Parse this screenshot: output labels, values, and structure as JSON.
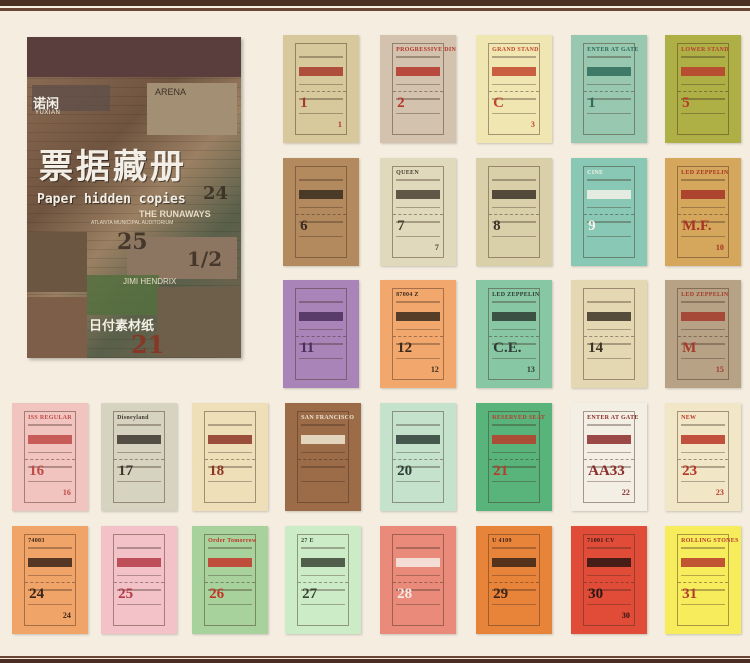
{
  "product": {
    "brand_cn": "诺闲",
    "brand_en": "YUXIAN",
    "title_cn": "票据藏册",
    "title_en": "Paper hidden copies",
    "subtitle_cn": "日付素材纸",
    "collage_texts": [
      "ARENA",
      "THE RUNAWAYS",
      "25",
      "24",
      "1/2",
      "JIMI HENDRIX",
      "21",
      "ATLANTA MUNICIPAL AUDITORIUM"
    ]
  },
  "colors": {
    "page_bg": "#f4ede0",
    "stripe": "#4a2e22",
    "cover_bg": "#3c2a26"
  },
  "cards": [
    {
      "color": "#d8c99c",
      "accent": "#a63a2a",
      "title": "",
      "num": "1",
      "alt": "1",
      "row": 1,
      "col": 1
    },
    {
      "color": "#d3c2ae",
      "accent": "#b4362a",
      "title": "PROGRESSIVE DINNER",
      "num": "2",
      "alt": "",
      "row": 1,
      "col": 2
    },
    {
      "color": "#f0e6b2",
      "accent": "#c2452c",
      "title": "GRAND STAND",
      "num": "C",
      "alt": "3",
      "row": 1,
      "col": 3
    },
    {
      "color": "#98c8b0",
      "accent": "#2e6c5a",
      "title": "ENTER AT GATE",
      "num": "1",
      "alt": "",
      "row": 1,
      "col": 4
    },
    {
      "color": "#aeb046",
      "accent": "#b83c2e",
      "title": "LOWER STAND",
      "num": "5",
      "alt": "",
      "row": 1,
      "col": 5
    },
    {
      "color": "#b28a5e",
      "accent": "#3a2c20",
      "title": "",
      "num": "6",
      "alt": "",
      "row": 2,
      "col": 1
    },
    {
      "color": "#e1d9bb",
      "accent": "#4a4033",
      "title": "QUEEN",
      "num": "7",
      "alt": "7",
      "row": 2,
      "col": 2
    },
    {
      "color": "#d9cfa8",
      "accent": "#3b3329",
      "title": "",
      "num": "8",
      "alt": "",
      "row": 2,
      "col": 3
    },
    {
      "color": "#88c8b4",
      "accent": "#f4f2ea",
      "title": "CINE",
      "num": "9",
      "alt": "",
      "row": 2,
      "col": 4
    },
    {
      "color": "#d5a75c",
      "accent": "#a63324",
      "title": "LED ZEPPELIN",
      "num": "M.F.",
      "alt": "10",
      "row": 2,
      "col": 5
    },
    {
      "color": "#a884b8",
      "accent": "#4b2f5a",
      "title": "",
      "num": "11",
      "alt": "",
      "row": 3,
      "col": 1
    },
    {
      "color": "#f2a86c",
      "accent": "#3a2a1c",
      "title": "87004 Z",
      "num": "12",
      "alt": "12",
      "row": 3,
      "col": 2
    },
    {
      "color": "#88c7a4",
      "accent": "#2d3c33",
      "title": "LED ZEPPELIN",
      "num": "C.E.",
      "alt": "13",
      "row": 3,
      "col": 3
    },
    {
      "color": "#e4d8b2",
      "accent": "#3c3426",
      "title": "",
      "num": "14",
      "alt": "",
      "row": 3,
      "col": 4
    },
    {
      "color": "#b8a286",
      "accent": "#a33a2a",
      "title": "LED ZEPPELIN",
      "num": "M",
      "alt": "15",
      "row": 3,
      "col": 5
    },
    {
      "color": "#f2c4c0",
      "accent": "#c04a45",
      "title": "ISS REGULAR",
      "num": "16",
      "alt": "16",
      "row": 4,
      "col": 1
    },
    {
      "color": "#d7d3c1",
      "accent": "#3c372e",
      "title": "Disneyland",
      "num": "17",
      "alt": "",
      "row": 4,
      "col": 2
    },
    {
      "color": "#eedfb8",
      "accent": "#8b3525",
      "title": "",
      "num": "18",
      "alt": "",
      "row": 4,
      "col": 3
    },
    {
      "color": "#9c6b48",
      "accent": "#efe6d2",
      "title": "SAN FRANCISCO",
      "num": "",
      "alt": "",
      "row": 4,
      "col": 4
    },
    {
      "color": "#c5e2cc",
      "accent": "#2e4036",
      "title": "",
      "num": "20",
      "alt": "",
      "row": 4,
      "col": 5
    },
    {
      "color": "#58b47a",
      "accent": "#b83c2d",
      "title": "RESERVED SEAT",
      "num": "21",
      "alt": "",
      "row": 4,
      "col": 6
    },
    {
      "color": "#f3efe4",
      "accent": "#8a2c2a",
      "title": "ENTER AT GATE",
      "num": "AA33",
      "alt": "22",
      "row": 4,
      "col": 7
    },
    {
      "color": "#f1e6c6",
      "accent": "#b83626",
      "title": "NEW",
      "num": "23",
      "alt": "23",
      "row": 4,
      "col": 8
    },
    {
      "color": "#f0a468",
      "accent": "#3b2518",
      "title": "74003",
      "num": "24",
      "alt": "24",
      "row": 5,
      "col": 1
    },
    {
      "color": "#f2c2c8",
      "accent": "#b43a46",
      "title": "",
      "num": "25",
      "alt": "",
      "row": 5,
      "col": 2
    },
    {
      "color": "#a8d29c",
      "accent": "#c2362a",
      "title": "Order Tomorrow",
      "num": "26",
      "alt": "",
      "row": 5,
      "col": 3
    },
    {
      "color": "#ccecc8",
      "accent": "#3a4535",
      "title": "27 E",
      "num": "27",
      "alt": "",
      "row": 5,
      "col": 4
    },
    {
      "color": "#ea8a7a",
      "accent": "#f6ebe5",
      "title": "",
      "num": "28",
      "alt": "",
      "row": 5,
      "col": 5
    },
    {
      "color": "#e8833a",
      "accent": "#3b2418",
      "title": "U 4109",
      "num": "29",
      "alt": "",
      "row": 5,
      "col": 6
    },
    {
      "color": "#e14c38",
      "accent": "#2a1612",
      "title": "71001 CV",
      "num": "30",
      "alt": "30",
      "row": 5,
      "col": 7
    },
    {
      "color": "#f6ec5c",
      "accent": "#b73a2c",
      "title": "ROLLING STONES",
      "num": "31",
      "alt": "",
      "row": 5,
      "col": 8
    }
  ]
}
